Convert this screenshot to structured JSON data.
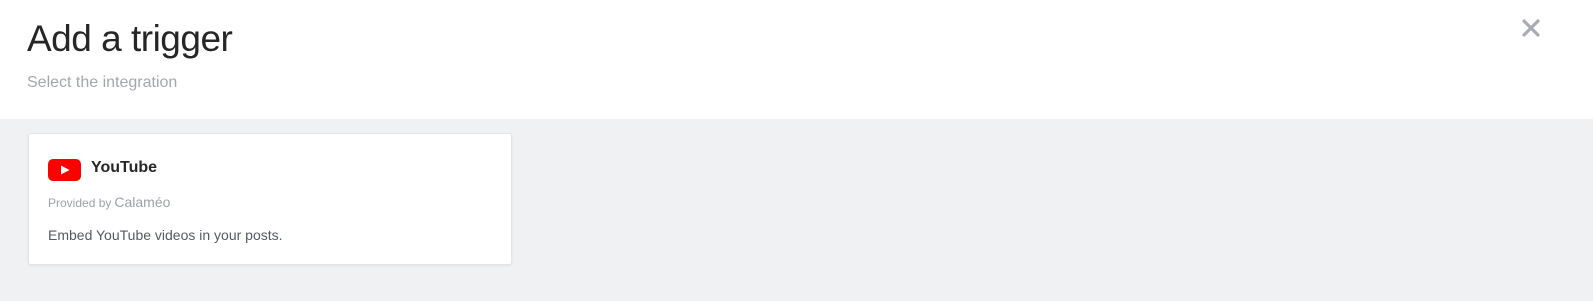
{
  "header": {
    "title": "Add a trigger",
    "subtitle": "Select the integration",
    "close_icon": "close-icon"
  },
  "integrations": [
    {
      "icon": "youtube-logo-icon",
      "name": "YouTube",
      "provided_by_prefix": "Provided by",
      "provider": "Calaméo",
      "description": "Embed YouTube videos in your posts.",
      "brand_color": "#ff0000"
    }
  ],
  "colors": {
    "header_bg": "#ffffff",
    "body_bg": "#f0f1f3",
    "title": "#262626",
    "subtitle": "#a3a7ad",
    "close_icon": "#a9abb0"
  }
}
